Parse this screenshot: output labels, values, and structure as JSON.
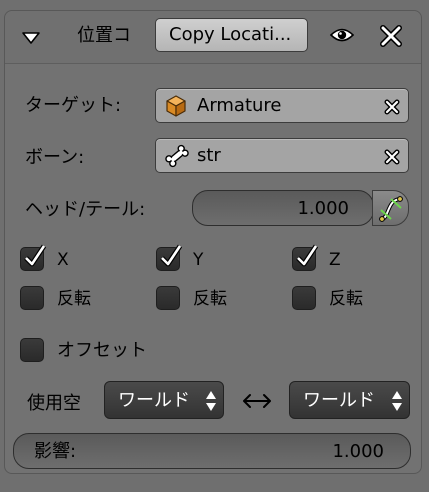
{
  "header": {
    "title": "位置コ",
    "copy_button": "Copy Locati..."
  },
  "target": {
    "label": "ターゲット:",
    "value": "Armature"
  },
  "bone": {
    "label": "ボーン:",
    "value": "str"
  },
  "head_tail": {
    "label": "ヘッド/テール:",
    "value": "1.000"
  },
  "axes": [
    {
      "label": "X",
      "checked": true,
      "invert_label": "反転"
    },
    {
      "label": "Y",
      "checked": true,
      "invert_label": "反転"
    },
    {
      "label": "Z",
      "checked": true,
      "invert_label": "反転"
    }
  ],
  "offset": {
    "label": "オフセット"
  },
  "space": {
    "label": "使用空",
    "owner": "ワールド",
    "target": "ワールド"
  },
  "influence": {
    "label": "影響:",
    "value": "1.000"
  },
  "icons": {
    "collapse": "triangle-down-icon",
    "visibility": "eye-icon",
    "remove": "close-icon",
    "armature": "cube-icon",
    "bone": "bone-icon",
    "curve": "curve-icon"
  }
}
